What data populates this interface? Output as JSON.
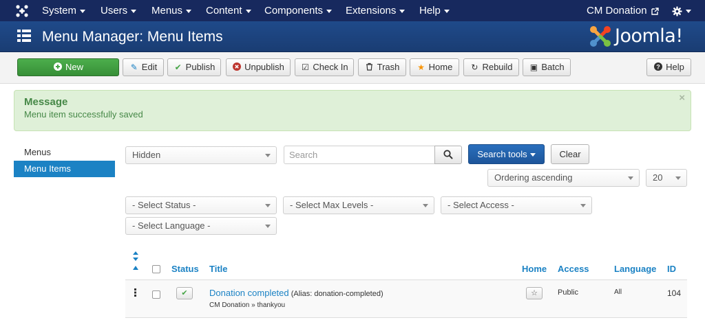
{
  "topbar": {
    "menus": [
      "System",
      "Users",
      "Menus",
      "Content",
      "Components",
      "Extensions",
      "Help"
    ],
    "site_link": "CM Donation"
  },
  "header": {
    "title": "Menu Manager: Menu Items",
    "logo_text": "Joomla!"
  },
  "toolbar": {
    "new": "New",
    "edit": "Edit",
    "publish": "Publish",
    "unpublish": "Unpublish",
    "checkin": "Check In",
    "trash": "Trash",
    "home": "Home",
    "rebuild": "Rebuild",
    "batch": "Batch",
    "help": "Help"
  },
  "message": {
    "heading": "Message",
    "text": "Menu item successfully saved",
    "close": "×"
  },
  "sidebar": {
    "items": [
      {
        "label": "Menus",
        "active": false
      },
      {
        "label": "Menu Items",
        "active": true
      }
    ]
  },
  "filters": {
    "menu_select": "Hidden",
    "search_placeholder": "Search",
    "search_tools": "Search tools",
    "clear": "Clear",
    "ordering": "Ordering ascending",
    "limit": "20",
    "status": "- Select Status -",
    "max_levels": "- Select Max Levels -",
    "access": "- Select Access -",
    "language": "- Select Language -"
  },
  "table": {
    "headers": {
      "status": "Status",
      "title": "Title",
      "home": "Home",
      "access": "Access",
      "language": "Language",
      "id": "ID"
    },
    "rows": [
      {
        "title": "Donation completed",
        "alias": "(Alias: donation-completed)",
        "path": "CM Donation » thankyou",
        "access": "Public",
        "language": "All",
        "id": "104",
        "published": true,
        "home": false
      }
    ]
  },
  "colors": {
    "navbar": "#17295e",
    "header": "#1f4a8a",
    "accent": "#1b82c4",
    "success": "#468847",
    "new_button": "#46a546"
  }
}
